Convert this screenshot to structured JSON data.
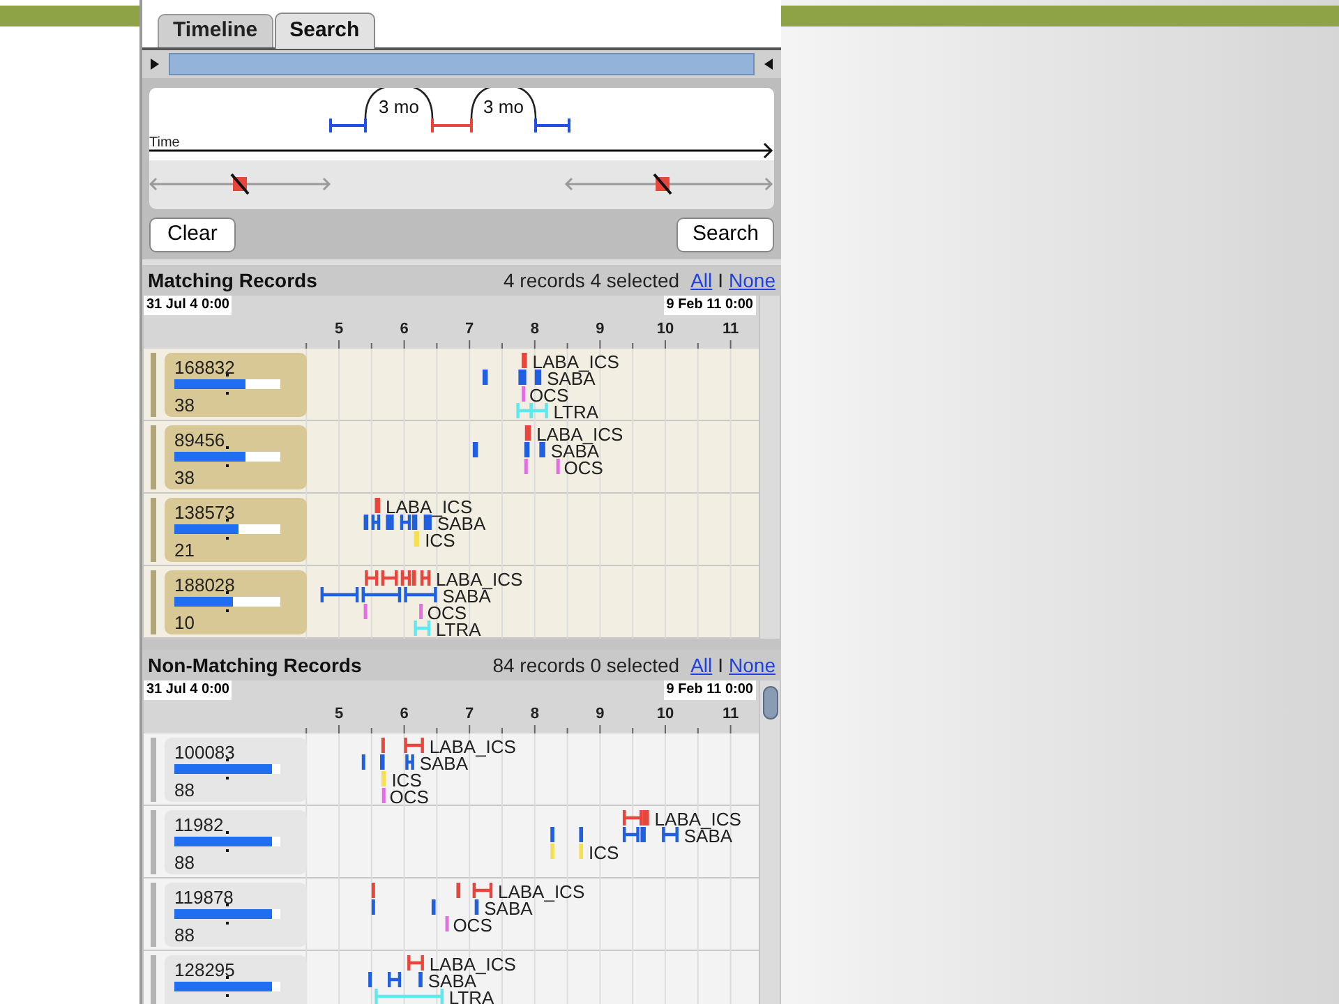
{
  "tabs": [
    {
      "label": "Timeline",
      "selected": false
    },
    {
      "label": "Search",
      "selected": true
    }
  ],
  "query": {
    "axis_label": "Time",
    "gaps": [
      {
        "label": "3 mo"
      },
      {
        "label": "3 mo"
      }
    ],
    "sliders": [
      {
        "level": 0.5
      },
      {
        "level": 0.47
      }
    ]
  },
  "buttons": {
    "clear": "Clear",
    "search": "Search"
  },
  "sections": [
    {
      "kind": "matching",
      "title": "Matching Records",
      "summary": "4 records 4 selected",
      "all_link": "All",
      "separator": "I",
      "none_link": "None",
      "start_date": "31 Jul 4 0:00",
      "end_date": "9 Feb 11 0:00",
      "ticks": [
        "5",
        "6",
        "7",
        "8",
        "9",
        "10",
        "11"
      ],
      "records": [
        {
          "id": "168832",
          "level": 0.67,
          "count": "38",
          "tracks": [
            {
              "label": "LABA_ICS",
              "color": "#e8453c"
            },
            {
              "label": "SABA",
              "color": "#1f5fe0"
            },
            {
              "label": "OCS",
              "color": "#e070e0"
            },
            {
              "label": "LTRA",
              "color": "#5ee8f0"
            }
          ]
        },
        {
          "id": "89456",
          "level": 0.67,
          "count": "38",
          "tracks": [
            {
              "label": "LABA_ICS",
              "color": "#e8453c"
            },
            {
              "label": "SABA",
              "color": "#1f5fe0"
            },
            {
              "label": "OCS",
              "color": "#e070e0"
            }
          ]
        },
        {
          "id": "138573",
          "level": 0.6,
          "count": "21",
          "tracks": [
            {
              "label": "LABA_ICS",
              "color": "#e8453c"
            },
            {
              "label": "SABA",
              "color": "#1f5fe0"
            },
            {
              "label": "ICS",
              "color": "#f5e050"
            }
          ]
        },
        {
          "id": "188028",
          "level": 0.55,
          "count": "10",
          "tracks": [
            {
              "label": "LABA_ICS",
              "color": "#e8453c"
            },
            {
              "label": "SABA",
              "color": "#1f5fe0"
            },
            {
              "label": "OCS",
              "color": "#e070e0"
            },
            {
              "label": "LTRA",
              "color": "#5ee8f0"
            }
          ]
        }
      ]
    },
    {
      "kind": "non_matching",
      "title": "Non-Matching Records",
      "summary": "84 records 0 selected",
      "all_link": "All",
      "separator": "I",
      "none_link": "None",
      "start_date": "31 Jul 4 0:00",
      "end_date": "9 Feb 11 0:00",
      "ticks": [
        "5",
        "6",
        "7",
        "8",
        "9",
        "10",
        "11"
      ],
      "records": [
        {
          "id": "100083",
          "level": 0.92,
          "count": "88",
          "tracks": [
            {
              "label": "LABA_ICS",
              "color": "#e8453c"
            },
            {
              "label": "SABA",
              "color": "#1f5fe0"
            },
            {
              "label": "ICS",
              "color": "#f5e050"
            },
            {
              "label": "OCS",
              "color": "#e070e0"
            }
          ]
        },
        {
          "id": "11982",
          "level": 0.92,
          "count": "88",
          "tracks": [
            {
              "label": "LABA_ICS",
              "color": "#e8453c"
            },
            {
              "label": "SABA",
              "color": "#1f5fe0"
            },
            {
              "label": "ICS",
              "color": "#f5e050"
            }
          ]
        },
        {
          "id": "119878",
          "level": 0.92,
          "count": "88",
          "tracks": [
            {
              "label": "LABA_ICS",
              "color": "#e8453c"
            },
            {
              "label": "SABA",
              "color": "#1f5fe0"
            },
            {
              "label": "OCS",
              "color": "#e070e0"
            }
          ]
        },
        {
          "id": "128295",
          "level": 0.92,
          "tracks": [
            {
              "label": "LABA_ICS",
              "color": "#e8453c"
            },
            {
              "label": "SABA",
              "color": "#1f5fe0"
            },
            {
              "label": "LTRA",
              "color": "#5ee8f0"
            }
          ]
        }
      ]
    }
  ]
}
